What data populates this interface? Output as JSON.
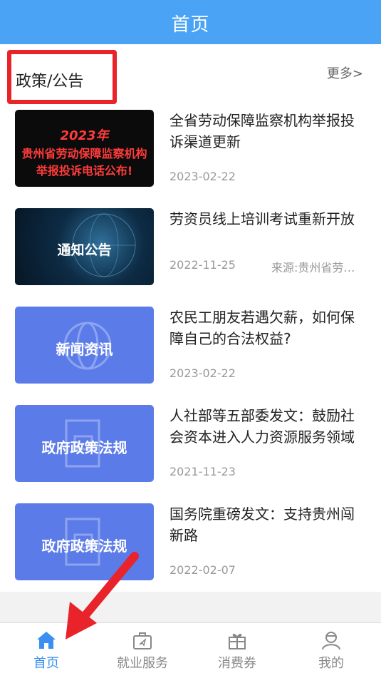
{
  "header": {
    "title": "首页"
  },
  "section": {
    "title": "政策/公告",
    "more": "更多>"
  },
  "news": [
    {
      "thumb_lines": [
        "2023年",
        "贵州省劳动保障监察机构",
        "举报投诉电话公布!"
      ],
      "headline": "全省劳动保障监察机构举报投诉渠道更新",
      "date": "2023-02-22",
      "source": ""
    },
    {
      "thumb_lines": [
        "通知公告"
      ],
      "headline": "劳资员线上培训考试重新开放",
      "date": "2022-11-25",
      "source": "来源:贵州省劳动保障监察局"
    },
    {
      "thumb_lines": [
        "新闻资讯"
      ],
      "headline": "农民工朋友若遇欠薪，如何保障自己的合法权益?",
      "date": "2023-02-22",
      "source": ""
    },
    {
      "thumb_lines": [
        "政府政策法规"
      ],
      "headline": "人社部等五部委发文：鼓励社会资本进入人力资源服务领域",
      "date": "2021-11-23",
      "source": ""
    },
    {
      "thumb_lines": [
        "政府政策法规"
      ],
      "headline": "国务院重磅发文：支持贵州闯新路",
      "date": "2022-02-07",
      "source": ""
    }
  ],
  "tabs": [
    {
      "label": "首页",
      "icon": "home-icon",
      "active": true
    },
    {
      "label": "就业服务",
      "icon": "briefcase-icon",
      "active": false
    },
    {
      "label": "消费券",
      "icon": "gift-icon",
      "active": false
    },
    {
      "label": "我的",
      "icon": "user-icon",
      "active": false
    }
  ],
  "colors": {
    "header": "#4aa3f5",
    "accent": "#3a8ff0",
    "highlight": "#e8232a",
    "thumb_blue": "#5b7be8"
  }
}
